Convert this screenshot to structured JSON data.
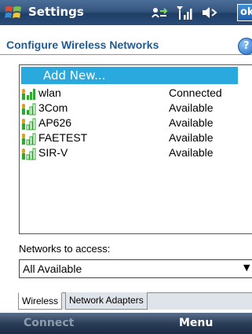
{
  "titlebar": {
    "title": "Settings",
    "ok_label": "ok",
    "icons": [
      "windows-start-icon",
      "connectivity-icon",
      "signal-strength-icon",
      "volume-icon"
    ]
  },
  "header": {
    "title": "Configure Wireless Networks",
    "help_icon": "help-icon",
    "help_glyph": "?"
  },
  "networks": {
    "add_new_label": "Add New...",
    "items": [
      {
        "name": "wlan",
        "status": "Connected"
      },
      {
        "name": "3Com",
        "status": "Available"
      },
      {
        "name": "AP626",
        "status": "Available"
      },
      {
        "name": "FAETEST",
        "status": "Available"
      },
      {
        "name": "SIR-V",
        "status": "Available"
      }
    ]
  },
  "access": {
    "label": "Networks to access:",
    "selected": "All Available"
  },
  "tabs": [
    {
      "label": "Wireless",
      "active": true
    },
    {
      "label": "Network Adapters",
      "active": false
    }
  ],
  "softkeys": {
    "left": "Connect",
    "right": "Menu"
  },
  "colors": {
    "selection": "#2aa9df",
    "title_text": "#1f5b94",
    "signal_green": "#2ea82e",
    "signal_gold": "#d8a21e"
  }
}
